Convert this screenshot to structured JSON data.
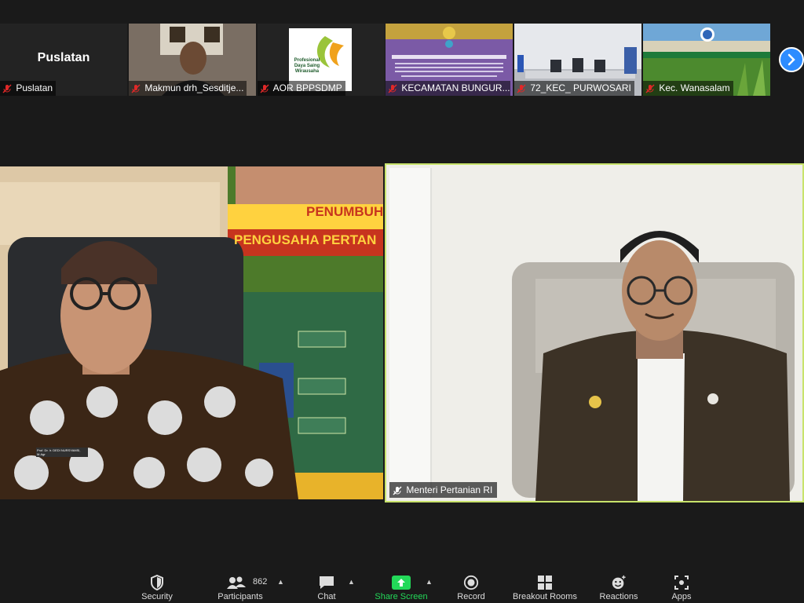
{
  "thumbnails": [
    {
      "name": "Puslatan",
      "big_label": "Puslatan",
      "muted": true
    },
    {
      "name": "Makmun drh_Sesditje...",
      "muted": true
    },
    {
      "name": "AOR BPPSDMP",
      "muted": true,
      "logo_text": "Profesional Daya Saing Wirausaha"
    },
    {
      "name": "KECAMATAN BUNGUR...",
      "muted": true
    },
    {
      "name": "72_KEC_ PURWOSARI",
      "muted": true
    },
    {
      "name": "Kec. Wanasalam",
      "muted": true
    }
  ],
  "left_video": {
    "banner_1": "PENUMBUH",
    "banner_2": "PENGUSAHA PERTAN",
    "name_badge": "Prof. Dr. Ir. DEDI NURSYAMSI, M.Agr"
  },
  "speaker": {
    "name": "Menteri Pertanian RI",
    "muted": true
  },
  "toolbar": {
    "security": "Security",
    "participants": "Participants",
    "participants_count": "862",
    "chat": "Chat",
    "share_screen": "Share Screen",
    "record": "Record",
    "breakout_rooms": "Breakout Rooms",
    "reactions": "Reactions",
    "apps": "Apps"
  },
  "colors": {
    "accent": "#2d8cff",
    "share_green": "#23d959",
    "active_speaker": "#c8e36b",
    "mute_red": "#e02828"
  }
}
